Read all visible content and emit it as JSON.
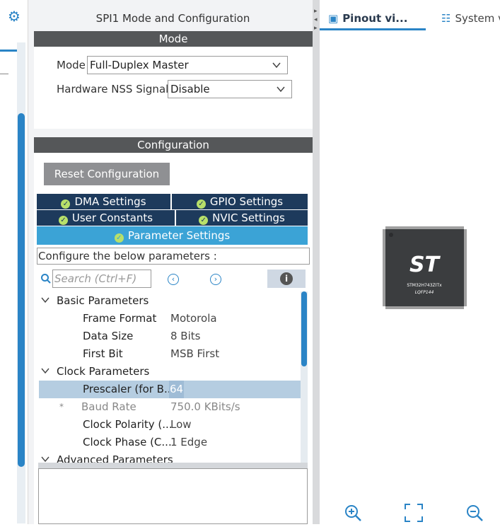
{
  "panel_title": "SPI1 Mode and Configuration",
  "mode_section": {
    "header": "Mode",
    "mode_label": "Mode",
    "mode_value": "Full-Duplex Master",
    "nss_label": "Hardware NSS Signal",
    "nss_value": "Disable"
  },
  "config_section": {
    "header": "Configuration",
    "reset_button": "Reset Configuration",
    "tabs": [
      {
        "label": "DMA Settings"
      },
      {
        "label": "GPIO Settings"
      },
      {
        "label": "User Constants"
      },
      {
        "label": "NVIC Settings"
      },
      {
        "label": "Parameter Settings"
      }
    ],
    "configure_label": "Configure the below parameters :",
    "search_placeholder": "Search (Ctrl+F)"
  },
  "tree": {
    "groups": [
      {
        "label": "Basic Parameters"
      },
      {
        "label": "Clock Parameters"
      },
      {
        "label": "Advanced Parameters"
      }
    ],
    "params": [
      {
        "name": "Frame Format",
        "value": "Motorola"
      },
      {
        "name": "Data Size",
        "value": "8 Bits"
      },
      {
        "name": "First Bit",
        "value": "MSB First"
      },
      {
        "name": "Prescaler (for B...",
        "value": "64"
      },
      {
        "name": "Baud Rate",
        "value": "750.0 KBits/s"
      },
      {
        "name": "Clock Polarity (...",
        "value": "Low"
      },
      {
        "name": "Clock Phase (C...",
        "value": "1 Edge"
      }
    ],
    "star": "*"
  },
  "right_panel": {
    "tab_pinout": "Pinout vi...",
    "tab_system": "System v",
    "chip_name": "STM32H743ZITx",
    "chip_package": "LQFP144"
  },
  "colors": {
    "accent": "#2a84c6",
    "header_dark": "#555759",
    "tab_dark": "#1d3a5c",
    "tab_active": "#3ba3d6",
    "selected_row": "#b5cde1"
  }
}
